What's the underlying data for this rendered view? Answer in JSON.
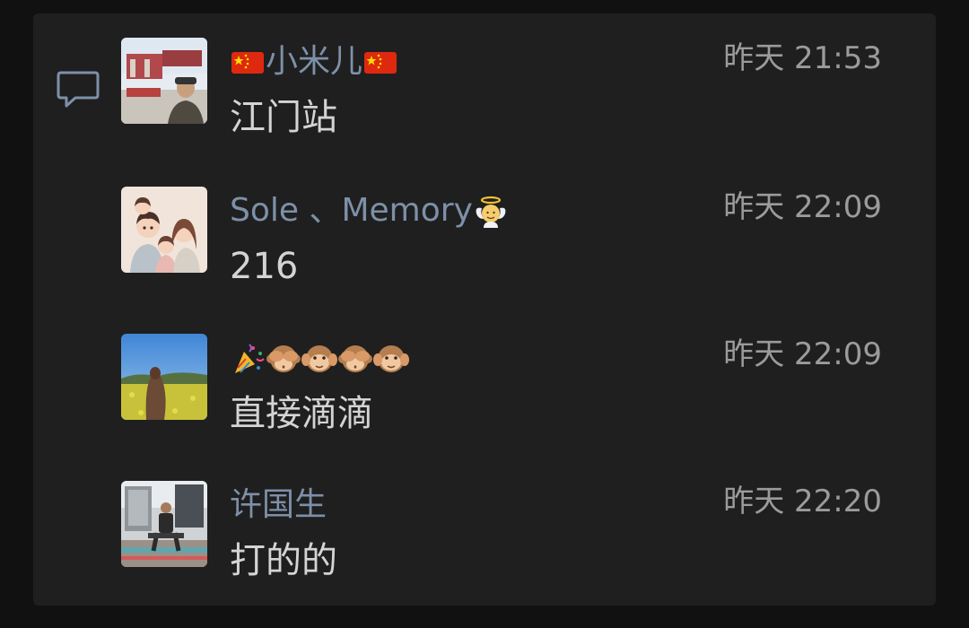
{
  "colors": {
    "background": "#111111",
    "panel": "#1f1f1f",
    "name": "#7d90a9",
    "text": "#d4d4d4",
    "time": "#9b9b9b"
  },
  "icons": {
    "comment": "comment-bubble-icon"
  },
  "messages": [
    {
      "avatar": "avatar-man-outdoors-photo",
      "name_prefix_emoji": "cn-flag-emoji",
      "name": "小米儿",
      "name_suffix_emoji": "cn-flag-emoji",
      "time": "昨天 21:53",
      "text": "江门站"
    },
    {
      "avatar": "avatar-cartoon-family",
      "name": "Sole 、Memory",
      "name_suffix_emoji": "angel-baby-emoji",
      "time": "昨天 22:09",
      "text": "216"
    },
    {
      "avatar": "avatar-girl-flower-field",
      "name_emojis": [
        "party-popper-emoji",
        "see-no-evil-monkey-emoji",
        "hear-no-evil-monkey-emoji",
        "see-no-evil-monkey-emoji",
        "hear-no-evil-monkey-emoji"
      ],
      "time": "昨天 22:09",
      "text": "直接滴滴"
    },
    {
      "avatar": "avatar-man-sitting-street",
      "name": "许国生",
      "time": "昨天 22:20",
      "text": "打的的"
    }
  ]
}
